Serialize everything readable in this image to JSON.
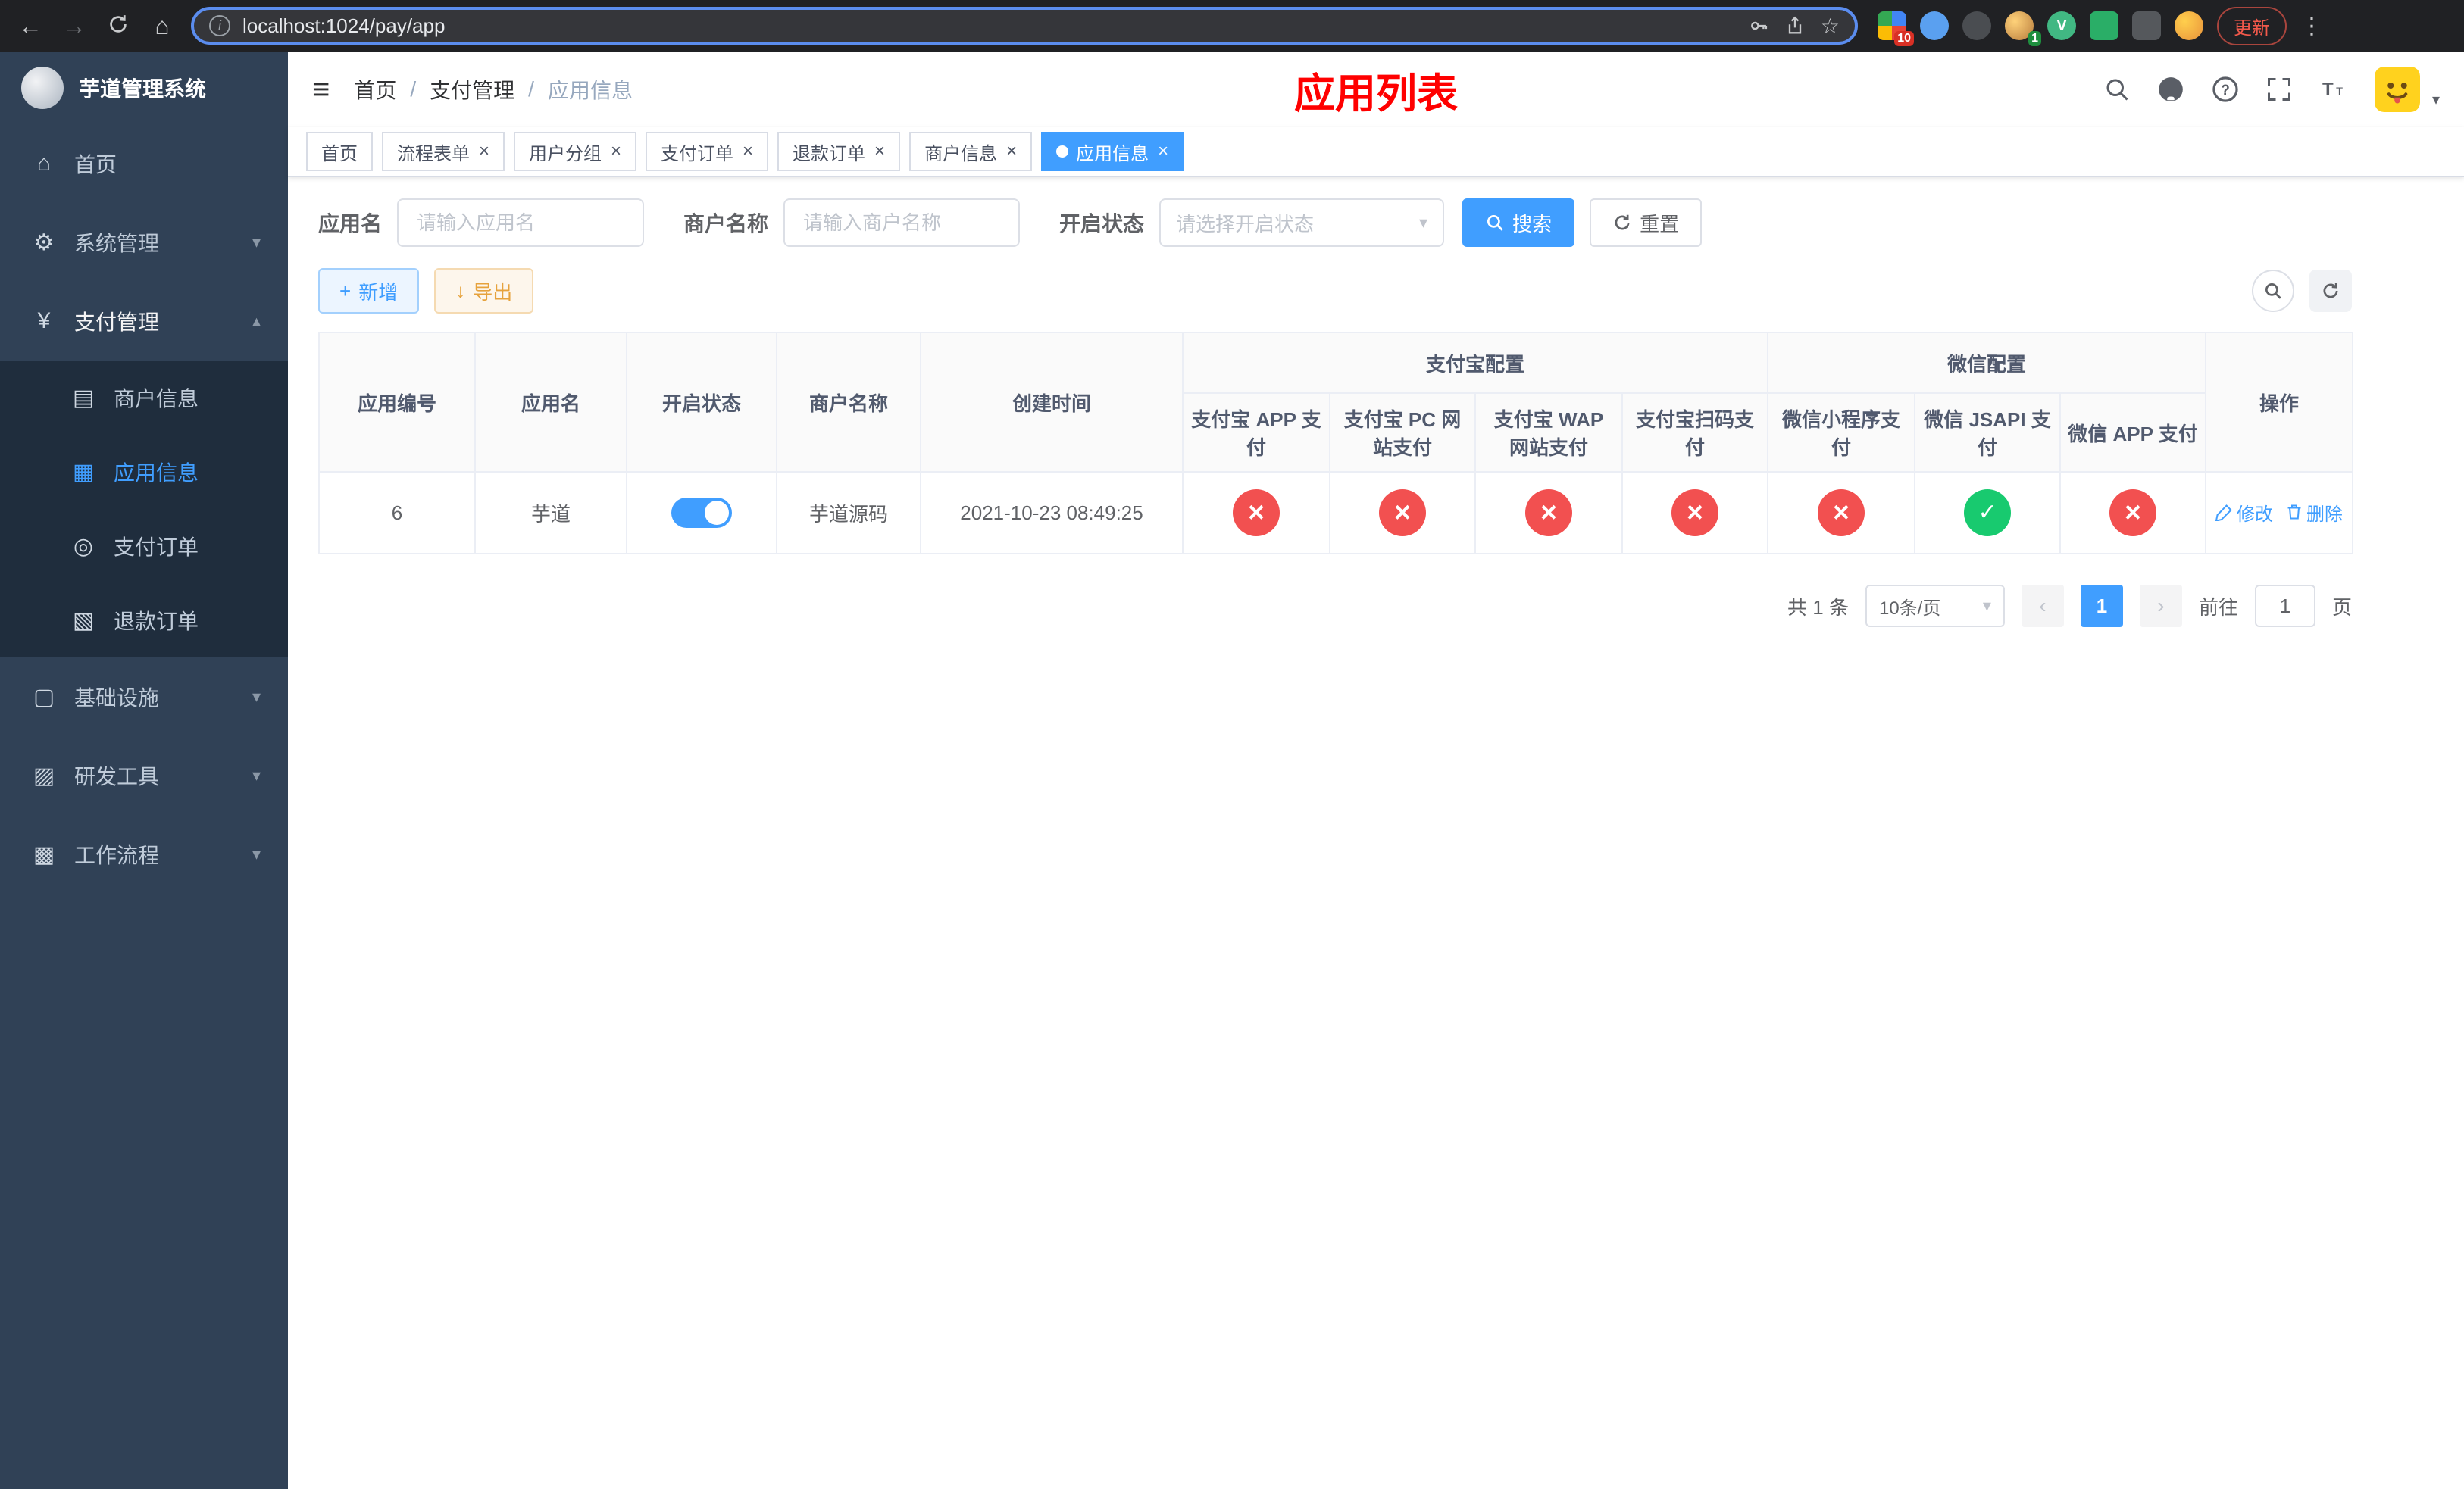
{
  "browser": {
    "url": "localhost:1024/pay/app",
    "update_label": "更新",
    "ext_badge_grid": "10",
    "ext_badge_avatar": "1",
    "vue_letter": "V"
  },
  "icons": {
    "back": "←",
    "forward": "→",
    "home": "⌂",
    "info": "i",
    "star": "☆",
    "menu_dots": "⋮",
    "hamburger": "≡",
    "chevron_down": "▾",
    "chevron_up": "▴",
    "caret_down": "▾",
    "prev": "‹",
    "next": "›",
    "close": "×",
    "plus": "+",
    "download": "↓",
    "question": "?",
    "menu_home": "⌂",
    "menu_system": "⚙",
    "menu_pay": "¥",
    "menu_merchant": "▤",
    "menu_app": "▦",
    "menu_order": "◎",
    "menu_refund": "▧",
    "menu_infra": "▢",
    "menu_devtool": "▨",
    "menu_workflow": "▩"
  },
  "sidebar": {
    "title": "芋道管理系统",
    "items": [
      {
        "label": "首页"
      },
      {
        "label": "系统管理"
      },
      {
        "label": "支付管理"
      },
      {
        "label": "基础设施"
      },
      {
        "label": "研发工具"
      },
      {
        "label": "工作流程"
      }
    ],
    "pay_children": [
      {
        "label": "商户信息"
      },
      {
        "label": "应用信息"
      },
      {
        "label": "支付订单"
      },
      {
        "label": "退款订单"
      }
    ]
  },
  "header": {
    "crumbs": [
      "首页",
      "支付管理",
      "应用信息"
    ],
    "page_title": "应用列表"
  },
  "tabs": [
    {
      "label": "首页"
    },
    {
      "label": "流程表单"
    },
    {
      "label": "用户分组"
    },
    {
      "label": "支付订单"
    },
    {
      "label": "退款订单"
    },
    {
      "label": "商户信息"
    },
    {
      "label": "应用信息"
    }
  ],
  "filters": {
    "app_name_label": "应用名",
    "app_name_placeholder": "请输入应用名",
    "merchant_name_label": "商户名称",
    "merchant_name_placeholder": "请输入商户名称",
    "status_label": "开启状态",
    "status_placeholder": "请选择开启状态",
    "search_label": "搜索",
    "reset_label": "重置"
  },
  "toolbar": {
    "add_label": "新增",
    "export_label": "导出"
  },
  "table": {
    "columns": {
      "id": "应用编号",
      "name": "应用名",
      "status": "开启状态",
      "merchant": "商户名称",
      "created": "创建时间",
      "alipay_group": "支付宝配置",
      "wechat_group": "微信配置",
      "alipay_app": "支付宝 APP 支付",
      "alipay_pc": "支付宝 PC 网站支付",
      "alipay_wap": "支付宝 WAP 网站支付",
      "alipay_qr": "支付宝扫码支付",
      "wx_mini": "微信小程序支付",
      "wx_jsapi": "微信 JSAPI 支付",
      "wx_app": "微信 APP 支付",
      "actions": "操作"
    },
    "rows": [
      {
        "id": "6",
        "name": "芋道",
        "enabled": true,
        "merchant": "芋道源码",
        "created": "2021-10-23 08:49:25",
        "channels": {
          "alipay_app": false,
          "alipay_pc": false,
          "alipay_wap": false,
          "alipay_qr": false,
          "wx_mini": false,
          "wx_jsapi": true,
          "wx_app": false
        },
        "edit_label": "修改",
        "delete_label": "删除"
      }
    ]
  },
  "pagination": {
    "total": "共 1 条",
    "page_size": "10条/页",
    "page": "1",
    "goto": "前往",
    "goto_value": "1",
    "unit": "页"
  }
}
